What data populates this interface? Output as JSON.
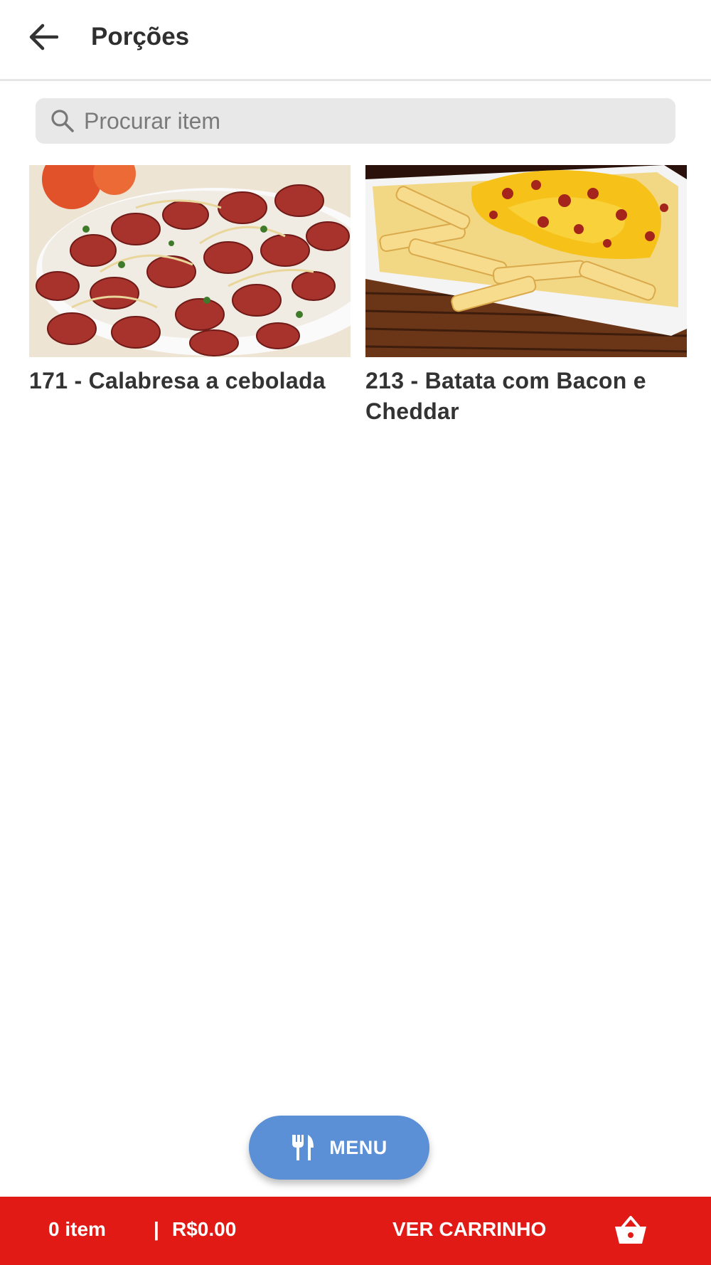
{
  "header": {
    "title": "Porções",
    "back_icon": "arrow-left-icon"
  },
  "search": {
    "placeholder": "Procurar item",
    "value": "",
    "icon": "search-icon"
  },
  "products": [
    {
      "name": "171 - Calabresa a cebolada"
    },
    {
      "name": "213 - Batata com Bacon e Cheddar"
    }
  ],
  "menu_button": {
    "label": "MENU",
    "icon": "utensils-icon",
    "color": "#5b8fd6"
  },
  "bottom_bar": {
    "item_count": "0 item",
    "divider": "|",
    "total": "R$0.00",
    "cart_label": "VER CARRINHO",
    "cart_icon": "basket-icon",
    "color": "#e11a15"
  }
}
